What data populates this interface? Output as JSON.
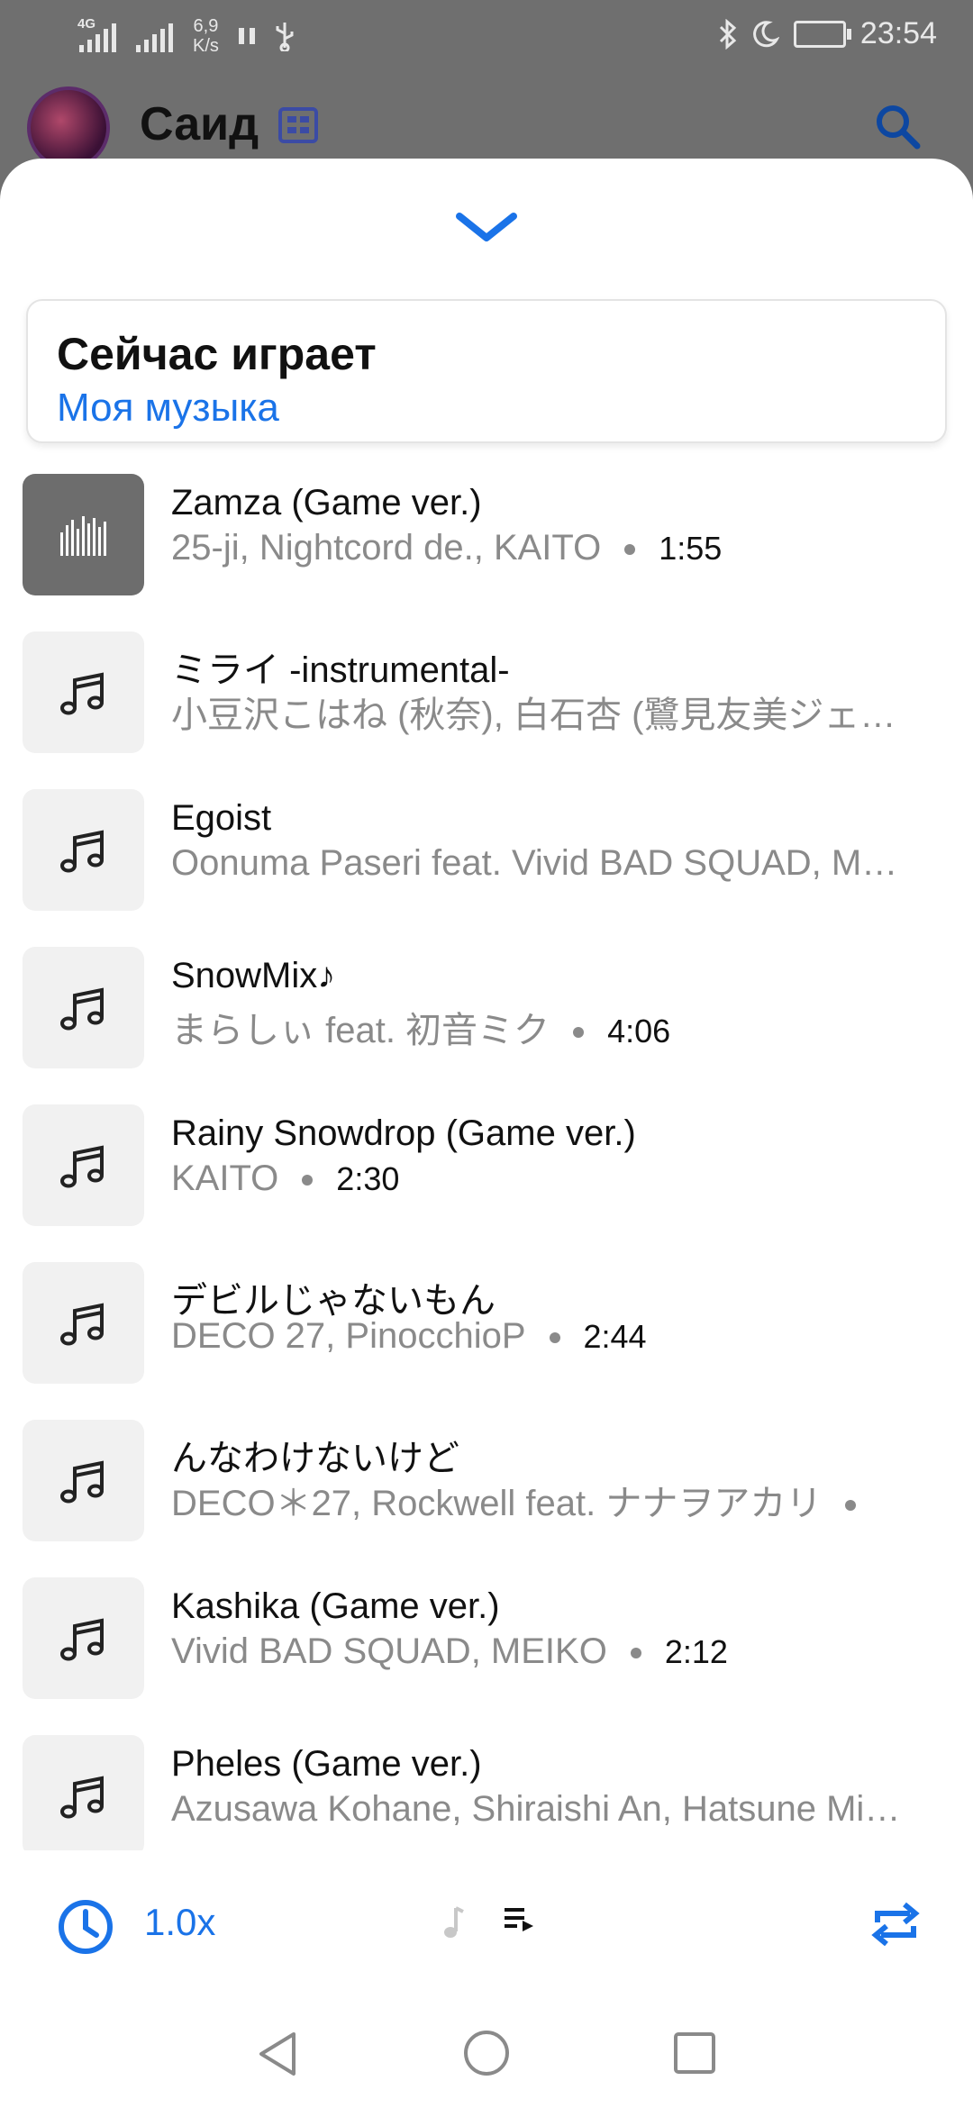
{
  "status": {
    "net1": "4G",
    "speed_value": "6,9",
    "speed_unit": "K/s",
    "time": "23:54"
  },
  "header": {
    "user_name": "Саид"
  },
  "now_playing": {
    "title": "Сейчас играет",
    "source": "Моя музыка"
  },
  "tracks": [
    {
      "title": "Zamza (Game ver.)",
      "artist": "25-ji, Nightcord de., KAITO",
      "duration": "1:55",
      "active": true
    },
    {
      "title": "ミライ -instrumental-",
      "artist": "小豆沢こはね (秋奈), 白石杏 (鷺見友美ジェ…",
      "duration": ""
    },
    {
      "title": "Egoist",
      "artist": "Oonuma Paseri feat. Vivid BAD SQUAD, M…",
      "duration": ""
    },
    {
      "title": "SnowMix♪",
      "artist": "まらしぃ feat. 初音ミク",
      "duration": "4:06"
    },
    {
      "title": "Rainy Snowdrop (Game ver.)",
      "artist": "KAITO",
      "duration": "2:30"
    },
    {
      "title": "デビルじゃないもん",
      "artist": "DECO 27, PinocchioP",
      "duration": "2:44"
    },
    {
      "title": "んなわけないけど",
      "artist": "DECO＊27, Rockwell feat. ナナヲアカリ",
      "duration": ""
    },
    {
      "title": "Kashika (Game ver.)",
      "artist": "Vivid BAD SQUAD, MEIKO",
      "duration": "2:12"
    },
    {
      "title": "Pheles (Game ver.)",
      "artist": "Azusawa Kohane, Shiraishi An, Hatsune Mi…",
      "duration": ""
    }
  ],
  "player": {
    "speed": "1.0x"
  },
  "colors": {
    "accent": "#1a73e8",
    "muted_text": "#8a8a8a"
  }
}
